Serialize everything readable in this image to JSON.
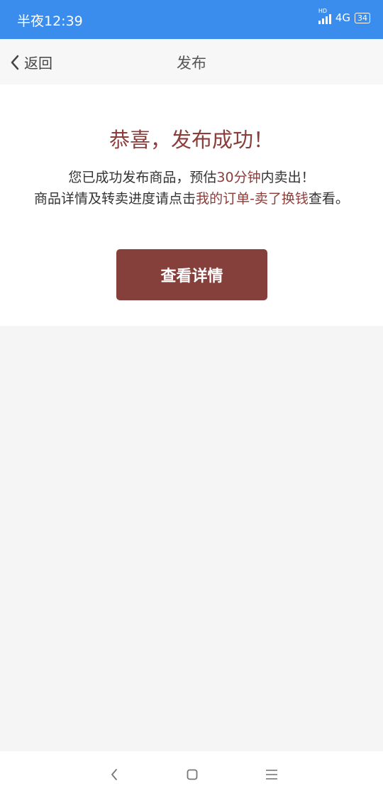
{
  "status_bar": {
    "time": "半夜12:39",
    "network": "4G",
    "hd_label": "HD",
    "battery": "34"
  },
  "nav": {
    "back_label": "返回",
    "title": "发布"
  },
  "content": {
    "success_title": "恭喜，发布成功！",
    "line1_prefix": "您已成功发布商品，预估",
    "line1_highlight": "30分钟",
    "line1_suffix": "内卖出！",
    "line2_prefix": "商品详情及转卖进度请点击",
    "line2_highlight": "我的订单-卖了换钱",
    "line2_suffix": "查看。",
    "button_label": "查看详情"
  },
  "colors": {
    "status_bar": "#3b8ded",
    "accent": "#8b3d3a",
    "button": "#86403b"
  }
}
